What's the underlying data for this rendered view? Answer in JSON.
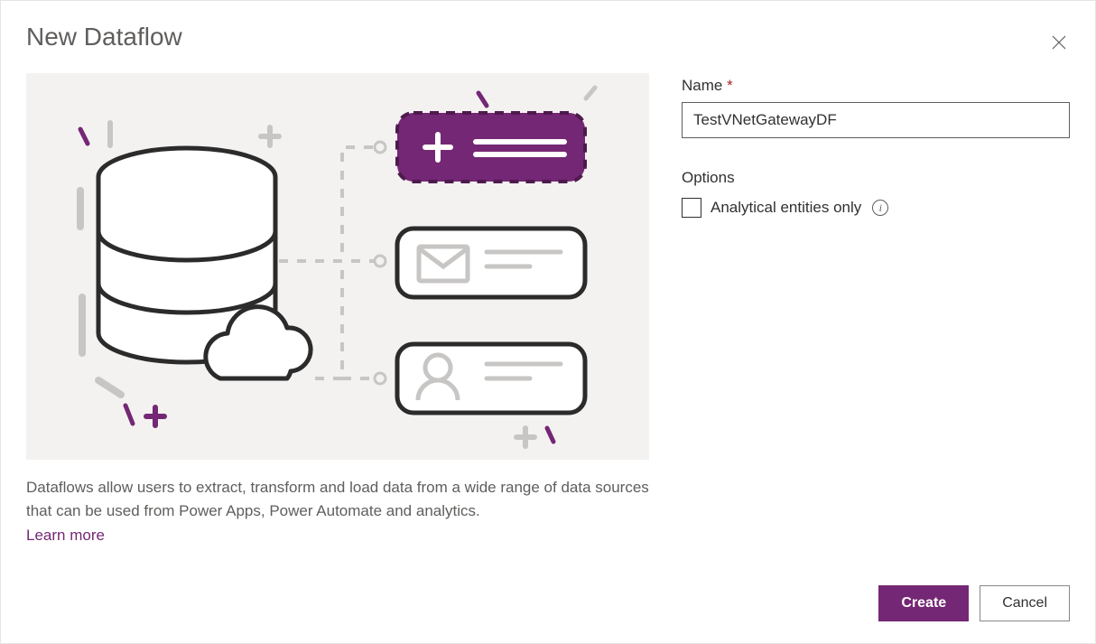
{
  "dialog": {
    "title": "New Dataflow",
    "close_aria": "Close"
  },
  "description": "Dataflows allow users to extract, transform and load data from a wide range of data sources that can be used from Power Apps, Power Automate and analytics.",
  "learn_more": "Learn more",
  "form": {
    "name_label": "Name",
    "name_value": "TestVNetGatewayDF",
    "options_header": "Options",
    "analytical_label": "Analytical entities only",
    "analytical_checked": false
  },
  "footer": {
    "create": "Create",
    "cancel": "Cancel"
  },
  "colors": {
    "accent": "#742774",
    "illustration_bg": "#f3f2f1"
  }
}
